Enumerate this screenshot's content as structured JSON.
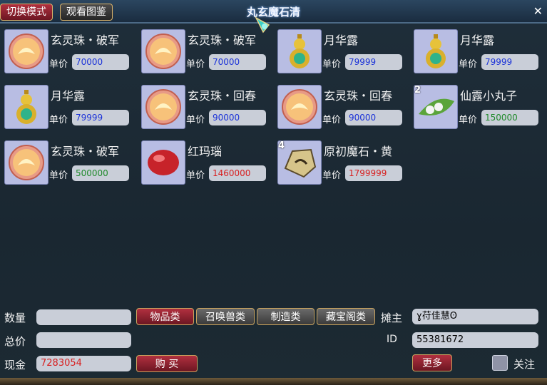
{
  "window": {
    "title": "丸玄魔石清",
    "close": "✕"
  },
  "topbar": {
    "switch_mode": "切换模式",
    "view_catalog": "观看图鉴"
  },
  "price_label": "单价",
  "items": [
    {
      "name": "玄灵珠・破军",
      "price": "70000",
      "price_color": "#1b32d8",
      "icon": "pearl-icon",
      "qty": ""
    },
    {
      "name": "玄灵珠・破军",
      "price": "70000",
      "price_color": "#1b32d8",
      "icon": "pearl-icon",
      "qty": ""
    },
    {
      "name": "月华露",
      "price": "79999",
      "price_color": "#1b32d8",
      "icon": "gourd-icon",
      "qty": ""
    },
    {
      "name": "月华露",
      "price": "79999",
      "price_color": "#1b32d8",
      "icon": "gourd-icon",
      "qty": ""
    },
    {
      "name": "月华露",
      "price": "79999",
      "price_color": "#1b32d8",
      "icon": "gourd-icon",
      "qty": ""
    },
    {
      "name": "玄灵珠・回春",
      "price": "90000",
      "price_color": "#1b32d8",
      "icon": "pearl-icon",
      "qty": ""
    },
    {
      "name": "玄灵珠・回春",
      "price": "90000",
      "price_color": "#1b32d8",
      "icon": "pearl-icon",
      "qty": ""
    },
    {
      "name": "仙露小丸子",
      "price": "150000",
      "price_color": "#1f8a2a",
      "icon": "pea-pod-icon",
      "qty": "2"
    },
    {
      "name": "玄灵珠・破军",
      "price": "500000",
      "price_color": "#1f8a2a",
      "icon": "pearl-icon",
      "qty": ""
    },
    {
      "name": "红玛瑙",
      "price": "1460000",
      "price_color": "#d81f1f",
      "icon": "agate-icon",
      "qty": ""
    },
    {
      "name": "原初魔石・黄",
      "price": "1799999",
      "price_color": "#d81f1f",
      "icon": "stone-icon",
      "qty": "4"
    }
  ],
  "form": {
    "quantity_label": "数量",
    "quantity_value": "",
    "total_label": "总价",
    "total_value": "",
    "cash_label": "现金",
    "cash_value": "7283054",
    "buy_button": "购 买"
  },
  "categories": [
    "物品类",
    "召唤兽类",
    "制造类",
    "藏宝阁类"
  ],
  "stall": {
    "owner_label": "摊主",
    "owner_value": "ɣ苻佳慧ʘ",
    "id_label": "ID",
    "id_value": "55381672",
    "more_button": "更多",
    "follow_label": "关注"
  }
}
